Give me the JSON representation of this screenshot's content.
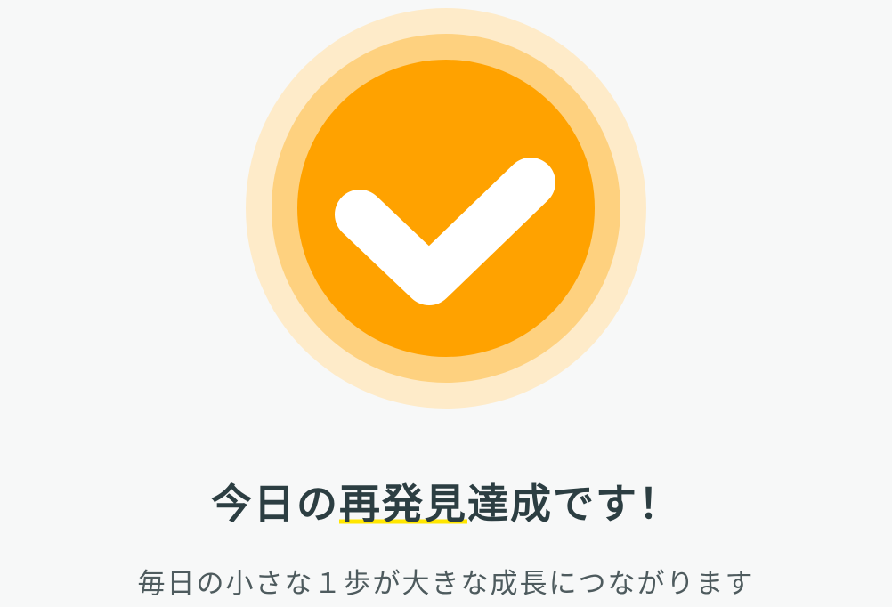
{
  "badge": {
    "icon": "check-icon",
    "colors": {
      "outer_ring": "#feebc9",
      "middle_ring": "#fed17f",
      "core": "#ffa200",
      "check": "#ffffff"
    }
  },
  "headline": {
    "before": "今日の",
    "highlight": "再発見",
    "after": "達成です！",
    "highlight_color": "#ffe600",
    "text_color": "#2c3e42"
  },
  "subtitle": "毎日の小さな１歩が大きな成長につながります",
  "page": {
    "background": "#f7f8f8"
  }
}
